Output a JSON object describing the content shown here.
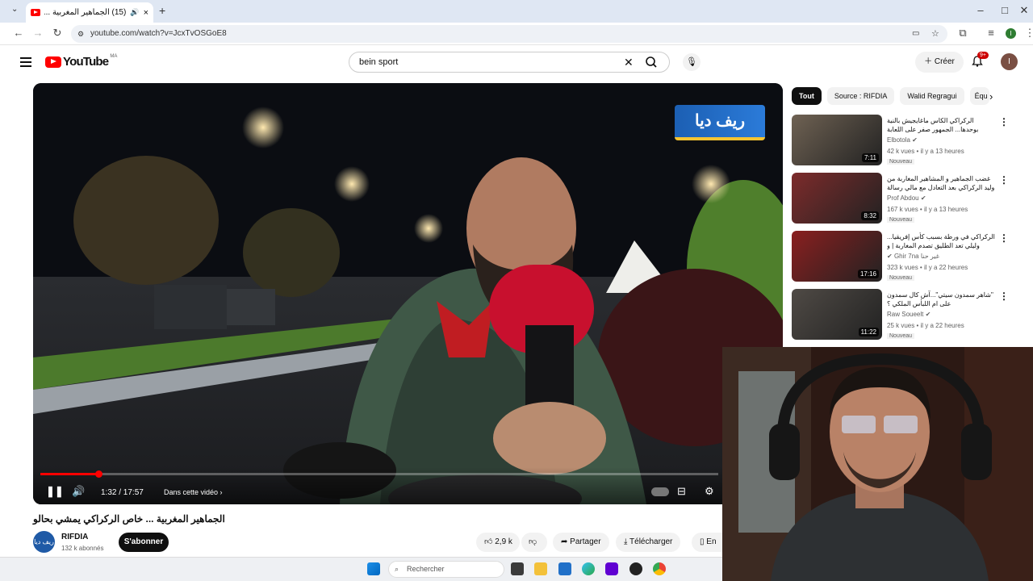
{
  "browser": {
    "tab_title": "(15) الجماهير المغربية ... خا",
    "url": "youtube.com/watch?v=JcxTvOSGoE8",
    "new_tab": "+",
    "profile_initial": "I"
  },
  "header": {
    "logo_text": "YouTube",
    "country_code": "MA",
    "search_query": "bein sport",
    "create_label": "Créer",
    "notifications_badge": "9+",
    "avatar_initial": "I"
  },
  "video": {
    "title": "الجماهير المغربية ... خاص الركراكي يمشي بحالو",
    "time_display": "1:32 / 17:57",
    "chapter_label": "Dans cette vidéo",
    "progress": 0.086,
    "logo_overlay": "ريف ديا"
  },
  "channel": {
    "name": "RIFDIA",
    "subscribers": "132 k abonnés",
    "subscribe_label": "S'abonner",
    "avatar_text": "ريف ديا"
  },
  "actions": {
    "likes": "2,9 k",
    "share": "Partager",
    "download": "Télécharger",
    "save": "En"
  },
  "sidebar": {
    "chips": [
      "Tout",
      "Source : RIFDIA",
      "Walid Regragui",
      "Équ"
    ],
    "recommendations": [
      {
        "title": "الركراكي الكاس ماغايجيش بالنية بوحدها... الجمهور صفر على اللعابة وكاعي على ...",
        "channel": "Elbotola",
        "meta": "42 k vues • il y a 13 heures",
        "badge": "Nouveau",
        "duration": "7:11",
        "thumb_color": "#6f6253"
      },
      {
        "title": "غضب الجماهير و المشاهير المغاربة من وليد الركراكي بعد التعادل مع مالي رسالة قاسية ...",
        "channel": "Prof Abdou",
        "meta": "167 k vues • il y a 13 heures",
        "badge": "Nouveau",
        "duration": "8:32",
        "thumb_color": "#7d2b2b"
      },
      {
        "title": "الركراكي في ورطة بسبب كأس إفريقيا... وليلي تعد الطليق تصدم المغاربة | و علاش ...",
        "channel": "Ghir 7na غير حنا",
        "meta": "323 k vues • il y a 22 heures",
        "badge": "Nouveau",
        "duration": "17:16",
        "thumb_color": "#8a1f1f"
      },
      {
        "title": "\"شاهر سمدون سيتي\"...آش كال سمدون على ام اللبأس الملكي ؟",
        "channel": "Raw Soueelt",
        "meta": "25 k vues • il y a 22 heures",
        "badge": "Nouveau",
        "duration": "11:22",
        "thumb_color": "#4f4a45"
      }
    ]
  },
  "taskbar": {
    "search_placeholder": "Rechercher"
  }
}
